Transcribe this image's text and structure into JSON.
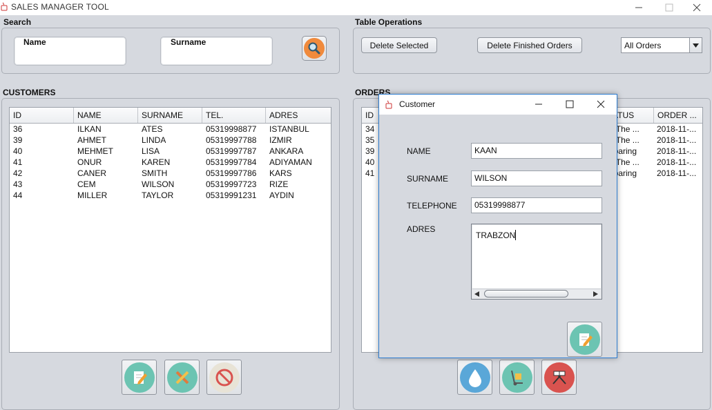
{
  "window": {
    "title": "SALES MANAGER TOOL",
    "minimize_icon": "minimize-icon",
    "maximize_icon": "maximize-icon",
    "close_icon": "close-icon"
  },
  "search": {
    "title": "Search",
    "name_label": "Name",
    "name_value": "",
    "surname_label": "Surname",
    "surname_value": "",
    "search_icon": "search-icon"
  },
  "table_ops": {
    "title": "Table Operations",
    "delete_selected": "Delete Selected",
    "delete_finished": "Delete Finished Orders",
    "filter_selected": "All Orders",
    "dropdown_icon": "chevron-down-icon"
  },
  "customers": {
    "title": "CUSTOMERS",
    "columns": [
      "ID",
      "NAME",
      "SURNAME",
      "TEL.",
      "ADRES"
    ],
    "rows": [
      [
        "36",
        "ILKAN",
        "ATES",
        "05319998877",
        "ISTANBUL"
      ],
      [
        "39",
        "AHMET",
        "LINDA",
        "05319997788",
        "IZMIR"
      ],
      [
        "40",
        "MEHMET",
        "LISA",
        "05319997787",
        "ANKARA"
      ],
      [
        "41",
        "ONUR",
        "KAREN",
        "05319997784",
        "ADIYAMAN"
      ],
      [
        "42",
        "CANER",
        "SMITH",
        "05319997786",
        "KARS"
      ],
      [
        "43",
        "CEM",
        "WILSON",
        "05319997723",
        "RIZE"
      ],
      [
        "44",
        "MILLER",
        "TAYLOR",
        "05319991231",
        "AYDIN"
      ]
    ],
    "buttons": [
      "edit-icon",
      "tools-icon",
      "no-entry-icon"
    ]
  },
  "orders": {
    "title": "ORDERS",
    "columns": [
      "ID",
      "ATUS",
      "ORDER ..."
    ],
    "rows": [
      [
        "34",
        "n The ...",
        "2018-11-..."
      ],
      [
        "35",
        "n The ...",
        "2018-11-..."
      ],
      [
        "39",
        "eparing",
        "2018-11-..."
      ],
      [
        "40",
        "n The ...",
        "2018-11-..."
      ],
      [
        "41",
        "eparing",
        "2018-11-..."
      ]
    ],
    "buttons": [
      "water-drop-icon",
      "hand-truck-icon",
      "checkered-flag-icon"
    ]
  },
  "dialog": {
    "title": "Customer",
    "name_label": "NAME",
    "name_value": "KAAN",
    "surname_label": "SURNAME",
    "surname_value": "WILSON",
    "telephone_label": "TELEPHONE",
    "telephone_value": "05319998877",
    "adres_label": "ADRES",
    "adres_value": "TRABZON",
    "save_icon": "edit-icon"
  },
  "colors": {
    "background": "#d6d9df",
    "accent_teal": "#6cc4b2",
    "accent_blue": "#5aa7d8",
    "accent_red": "#d9534f",
    "search_orange": "#f08a3c",
    "dialog_border": "#2b7bd0"
  }
}
